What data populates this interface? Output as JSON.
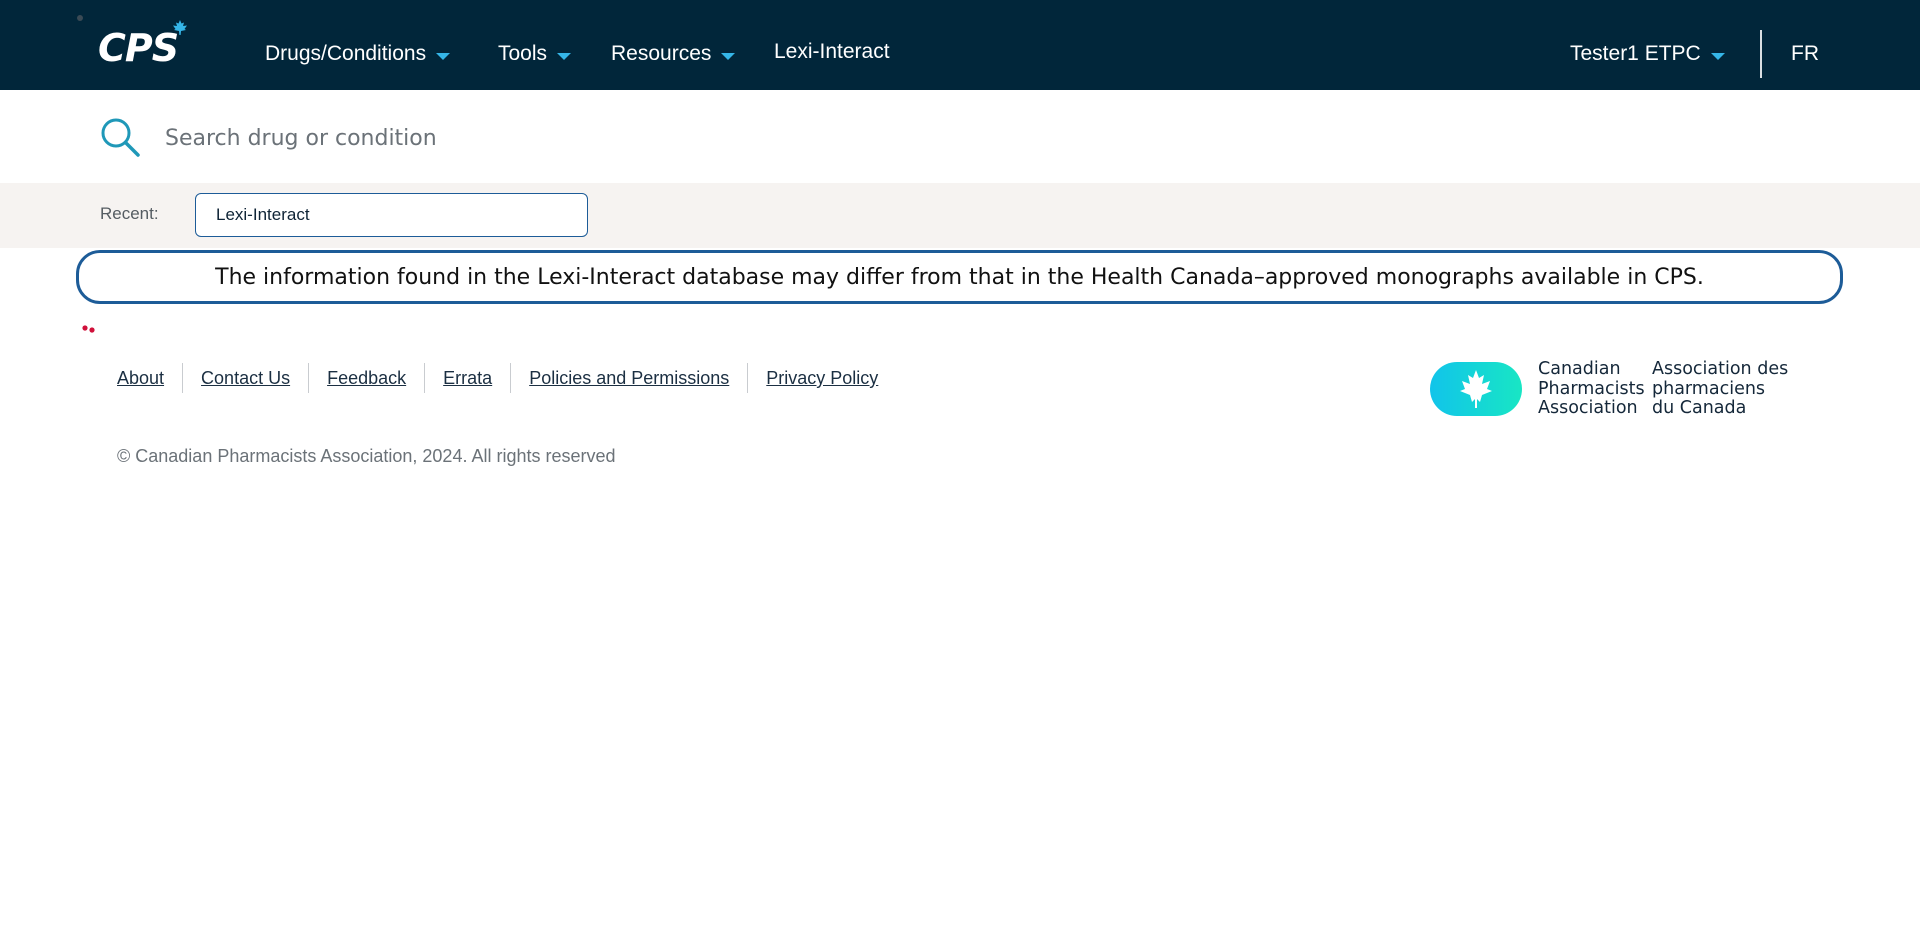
{
  "header": {
    "logo_text": "CPS",
    "nav": [
      {
        "label": "Drugs/Conditions",
        "has_dropdown": true
      },
      {
        "label": "Tools",
        "has_dropdown": true
      },
      {
        "label": "Resources",
        "has_dropdown": true
      },
      {
        "label": "Lexi-Interact",
        "has_dropdown": false
      }
    ],
    "user_label": "Tester1 ETPC",
    "language_label": "FR",
    "colors": {
      "background": "#01263a",
      "caret": "#35b6e8"
    }
  },
  "search": {
    "placeholder": "Search drug or condition",
    "value": "",
    "icon": "search-icon"
  },
  "recent": {
    "label": "Recent:",
    "items": [
      "Lexi-Interact"
    ]
  },
  "banner": {
    "text": "The information found in the Lexi-Interact database may differ from that in the Health Canada–approved monographs available in CPS."
  },
  "footer": {
    "links": [
      "About",
      "Contact Us",
      "Feedback",
      "Errata",
      "Policies and Permissions",
      "Privacy Policy"
    ],
    "copyright": "© Canadian Pharmacists Association, 2024. All rights reserved",
    "org_name_en": [
      "Canadian",
      "Pharmacists",
      "Association"
    ],
    "org_name_fr": [
      "Association des",
      "pharmaciens",
      "du Canada"
    ]
  }
}
